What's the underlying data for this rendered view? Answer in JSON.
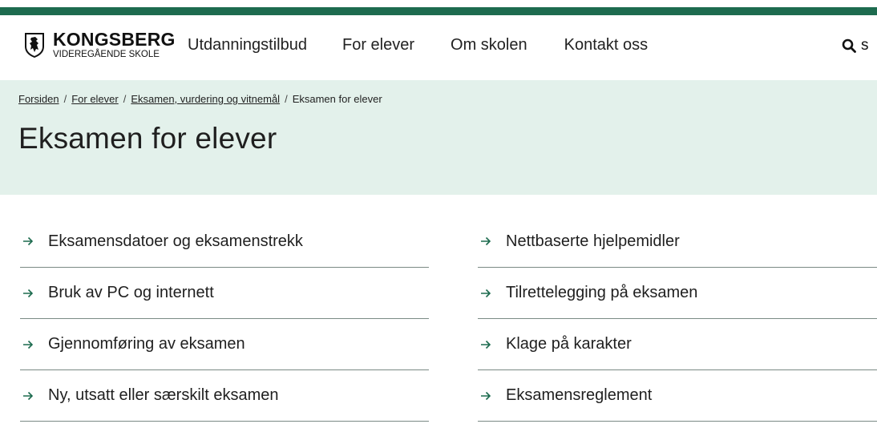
{
  "brand": {
    "name": "KONGSBERG",
    "subtitle": "VIDEREGÅENDE SKOLE",
    "accent_color": "#1d6b4f",
    "hero_color": "#e3f1eb"
  },
  "nav": {
    "items": [
      "Utdanningstilbud",
      "For elever",
      "Om skolen",
      "Kontakt oss"
    ]
  },
  "search": {
    "icon": "search-icon",
    "label": "s"
  },
  "breadcrumb": {
    "items": [
      "Forsiden",
      "For elever",
      "Eksamen, vurdering og vitnemål"
    ],
    "current": "Eksamen for elever",
    "separator": "/"
  },
  "page": {
    "title": "Eksamen for elever"
  },
  "links": {
    "left": [
      "Eksamensdatoer og eksamenstrekk",
      "Bruk av PC og internett",
      "Gjennomføring av eksamen",
      "Ny, utsatt eller særskilt eksamen"
    ],
    "right": [
      "Nettbaserte hjelpemidler",
      "Tilrettelegging på eksamen",
      "Klage på karakter",
      "Eksamensreglement"
    ]
  }
}
